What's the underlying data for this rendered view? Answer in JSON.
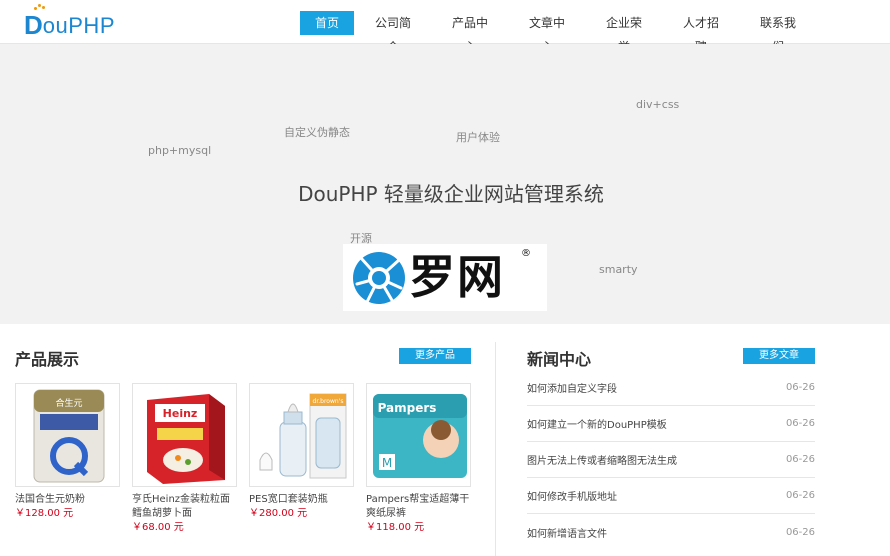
{
  "header": {
    "logo": {
      "d": "D",
      "rest": "ouPHP"
    },
    "nav": [
      "首页",
      "公司简介",
      "产品中心",
      "文章中心",
      "企业荣誉",
      "人才招聘",
      "联系我们"
    ],
    "active_index": 0
  },
  "banner": {
    "title": "DouPHP 轻量级企业网站管理系统",
    "tags": [
      "div+css",
      "自定义伪静态",
      "用户体验",
      "php+mysql",
      "开源",
      "smarty"
    ],
    "watermark": {
      "text": "罗网",
      "reg": "®"
    }
  },
  "products": {
    "title": "产品展示",
    "more_label": "更多产品",
    "items": [
      {
        "name": "法国合生元奶粉",
        "price": "￥128.00 元"
      },
      {
        "name": "亨氏Heinz金装粒粒面鳕鱼胡萝卜面",
        "price": "￥68.00 元"
      },
      {
        "name": "PES宽口套装奶瓶",
        "price": "￥280.00 元"
      },
      {
        "name": "Pampers帮宝适超薄干爽纸尿裤",
        "price": "￥118.00 元"
      }
    ],
    "image_labels": [
      "合生元",
      "Heinz",
      "dr.brown's",
      "Pampers"
    ]
  },
  "news": {
    "title": "新闻中心",
    "more_label": "更多文章",
    "items": [
      {
        "title": "如何添加自定义字段",
        "date": "06-26"
      },
      {
        "title": "如何建立一个新的DouPHP模板",
        "date": "06-26"
      },
      {
        "title": "图片无法上传或者缩略图无法生成",
        "date": "06-26"
      },
      {
        "title": "如何修改手机版地址",
        "date": "06-26"
      },
      {
        "title": "如何新增语言文件",
        "date": "06-26"
      }
    ]
  },
  "colors": {
    "accent": "#19a3e0",
    "logo": "#1c86d1",
    "price": "#d0021b",
    "banner_bg": "#f2f2f2"
  }
}
